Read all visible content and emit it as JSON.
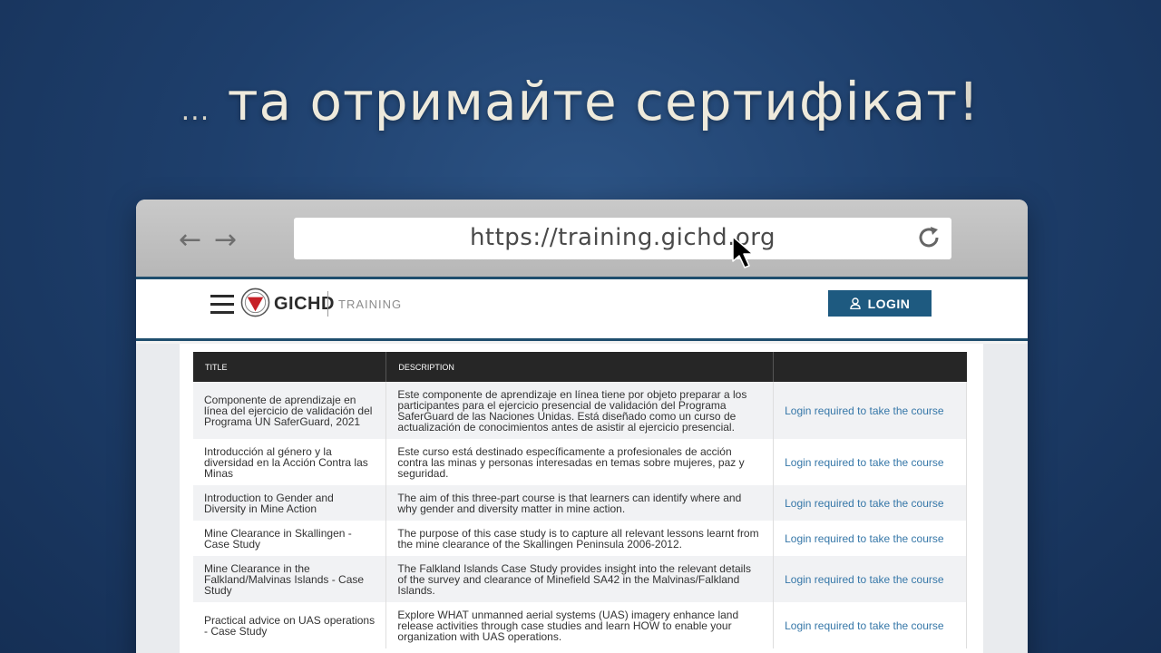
{
  "headline": {
    "dots": "...",
    "text": "та отримайте сертифікат",
    "bang": "!"
  },
  "browser": {
    "url": "https://training.gichd.org",
    "back_icon": "arrow-left-icon",
    "forward_icon": "arrow-right-icon",
    "reload_icon": "reload-icon"
  },
  "site": {
    "logo": "GICHD",
    "section": "TRAINING",
    "login_label": "LOGIN"
  },
  "table": {
    "headers": [
      "TITLE",
      "DESCRIPTION",
      ""
    ],
    "rows": [
      {
        "title": "Componente de aprendizaje en línea del ejercicio de validación del Programa UN SaferGuard, 2021",
        "description": "Este componente de aprendizaje en línea tiene por objeto preparar a los participantes para el ejercicio presencial de validación del Programa SaferGuard de las Naciones Unidas. Está diseñado como un curso de actualización de conocimientos antes de asistir al ejercicio presencial.",
        "action": "Login required to take the course"
      },
      {
        "title": "Introducción al género y la diversidad en la Acción Contra las Minas",
        "description": "Este curso está destinado específicamente a profesionales de acción contra las minas y personas interesadas en temas sobre mujeres, paz y seguridad.",
        "action": "Login required to take the course"
      },
      {
        "title": "Introduction to Gender and Diversity in Mine Action",
        "description": "The aim of this three-part course is that learners can identify where and why gender and diversity matter in mine action.",
        "action": "Login required to take the course"
      },
      {
        "title": "Mine Clearance in Skallingen - Case Study",
        "description": "The purpose of this case study is to capture all relevant lessons learnt from the mine clearance of the Skallingen Peninsula 2006-2012.",
        "action": "Login required to take the course"
      },
      {
        "title": "Mine Clearance in the Falkland/Malvinas Islands - Case Study",
        "description": "The Falkland Islands Case Study provides insight into the relevant details of the survey and clearance of Minefield SA42 in the Malvinas/Falkland Islands.",
        "action": "Login required to take the course"
      },
      {
        "title": "Practical advice on UAS operations - Case Study",
        "description": "Explore WHAT unmanned aerial systems (UAS) imagery enhance land release activities through case studies and learn HOW to enable your organization with UAS operations.",
        "action": "Login required to take the course"
      }
    ]
  }
}
